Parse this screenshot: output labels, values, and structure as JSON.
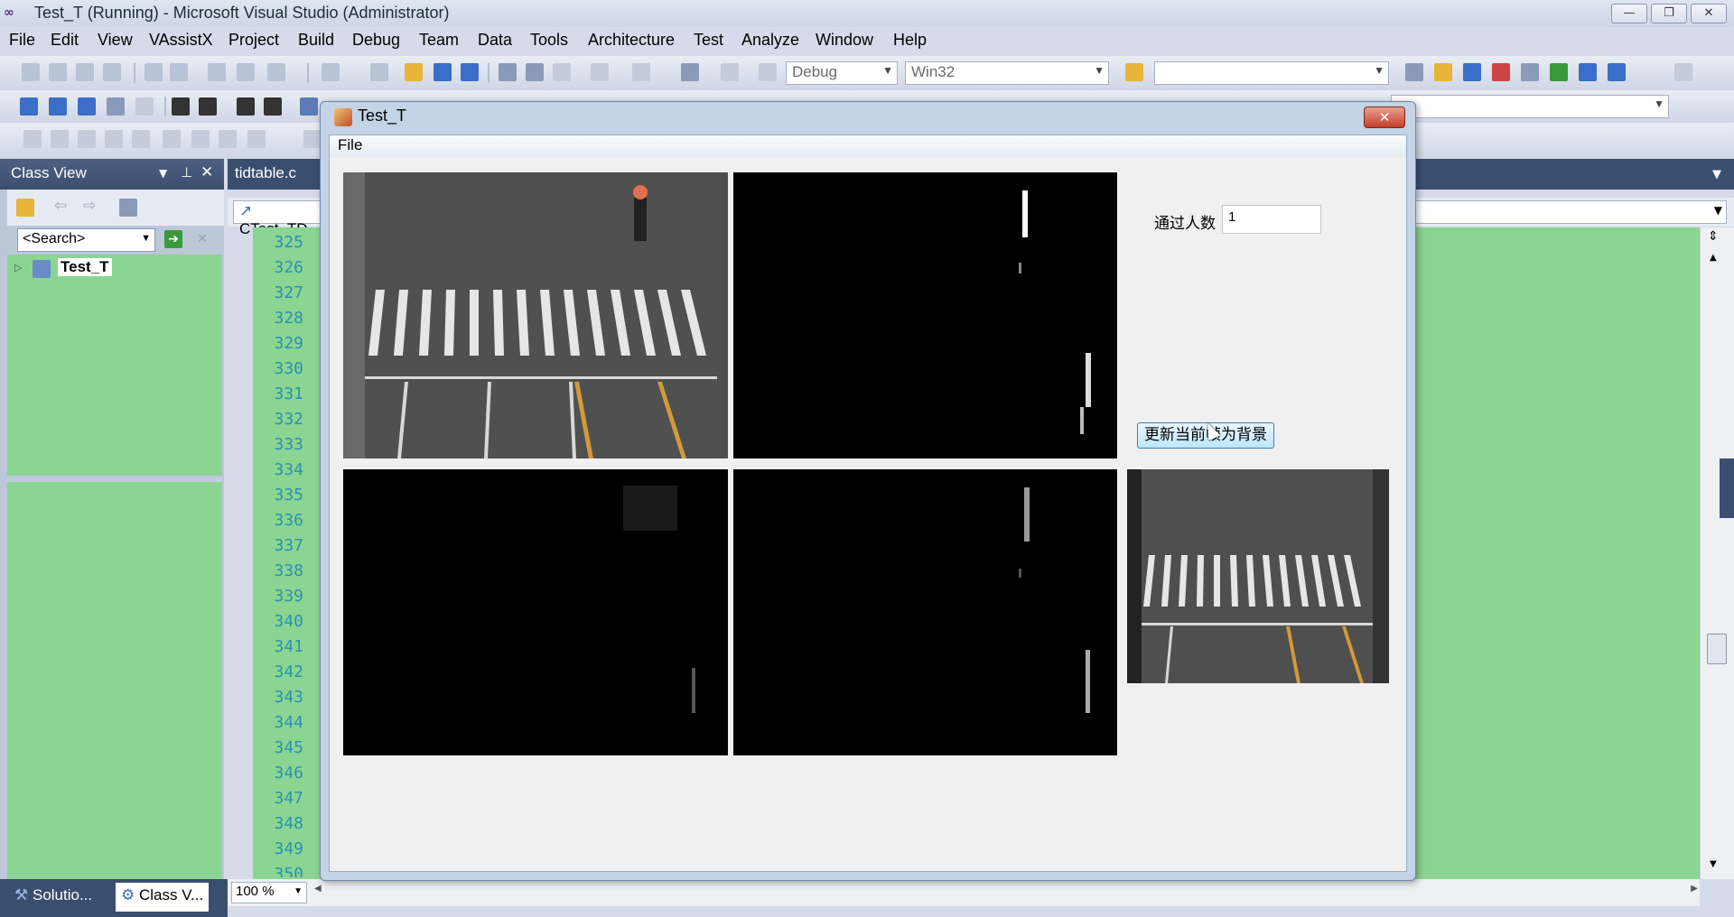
{
  "window": {
    "title": "Test_T (Running) - Microsoft Visual Studio (Administrator)",
    "minimize": "—",
    "restore": "❐",
    "close": "✕"
  },
  "menu": [
    "File",
    "Edit",
    "View",
    "VAssistX",
    "Project",
    "Build",
    "Debug",
    "Team",
    "Data",
    "Tools",
    "Architecture",
    "Test",
    "Analyze",
    "Window",
    "Help"
  ],
  "toolbar": {
    "config": "Debug",
    "platform": "Win32",
    "find_value": ""
  },
  "classview": {
    "title": "Class View",
    "search_placeholder": "<Search>",
    "tree_root": "Test_T"
  },
  "editor": {
    "tab": "tidtable.c",
    "nav": "CTest_TD",
    "zoom": "100 %",
    "line_numbers": [
      "325",
      "326",
      "327",
      "328",
      "329",
      "330",
      "331",
      "332",
      "333",
      "334",
      "335",
      "336",
      "337",
      "338",
      "339",
      "340",
      "341",
      "342",
      "343",
      "344",
      "345",
      "346",
      "347",
      "348",
      "349",
      "350"
    ]
  },
  "bottom_tabs": [
    "Solutio...",
    "Class V..."
  ],
  "dialog": {
    "title": "Test_T",
    "close": "✕",
    "menu_file": "File",
    "count_label": "通过人数",
    "count_value": "1",
    "update_button": "更新当前帧为背景"
  },
  "colors": {
    "editor_bg": "#8bd592",
    "line_number": "#2b91af",
    "chrome_dark": "#3a4e70"
  }
}
